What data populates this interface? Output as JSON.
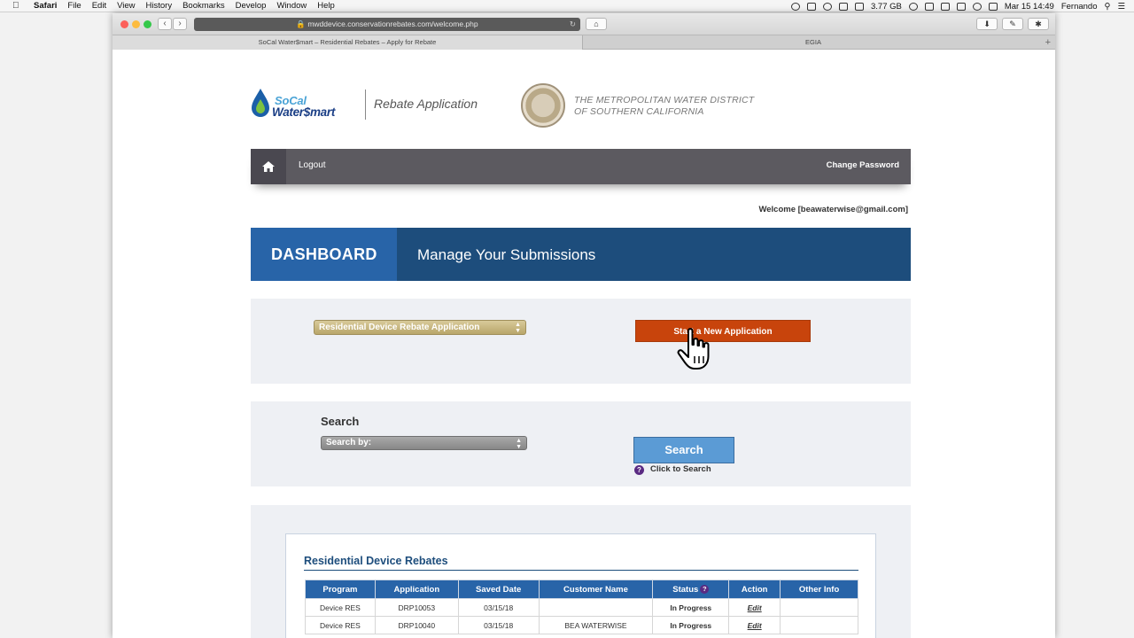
{
  "menubar": {
    "app": "Safari",
    "items": [
      "File",
      "Edit",
      "View",
      "History",
      "Bookmarks",
      "Develop",
      "Window",
      "Help"
    ],
    "storage": "3.77 GB",
    "clock": "Mar 15  14:49",
    "user": "Fernando"
  },
  "browser": {
    "url": "mwddevice.conservationrebates.com/welcome.php",
    "tabs": [
      {
        "label": "SoCal Water$mart – Residential Rebates – Apply for Rebate"
      },
      {
        "label": "EGIA"
      }
    ]
  },
  "header": {
    "logo_line1": "SoCal",
    "logo_line2": "Water$mart",
    "rebate_title": "Rebate Application",
    "mwd_line1": "THE METROPOLITAN WATER DISTRICT",
    "mwd_line2": "OF SOUTHERN CALIFORNIA"
  },
  "nav": {
    "logout": "Logout",
    "change_password": "Change Password"
  },
  "welcome": "Welcome [beawaterwise@gmail.com]",
  "dashboard": {
    "label": "DASHBOARD",
    "subtitle": "Manage Your Submissions"
  },
  "application_panel": {
    "selected_program": "Residential Device Rebate Application",
    "start_button": "Start a New Application"
  },
  "search_panel": {
    "label": "Search",
    "search_by": "Search by:",
    "search_button": "Search",
    "hint": "Click to Search"
  },
  "rebates": {
    "title": "Residential Device Rebates",
    "columns": [
      "Program",
      "Application",
      "Saved Date",
      "Customer Name",
      "Status",
      "Action",
      "Other Info"
    ],
    "rows": [
      {
        "program": "Device RES",
        "application": "DRP10053",
        "saved_date": "03/15/18",
        "customer": "",
        "status": "In Progress",
        "action": "Edit",
        "other": ""
      },
      {
        "program": "Device RES",
        "application": "DRP10040",
        "saved_date": "03/15/18",
        "customer": "BEA WATERWISE",
        "status": "In Progress",
        "action": "Edit",
        "other": ""
      }
    ]
  },
  "colors": {
    "nav_bg": "#5c5a60",
    "dashboard_dark": "#1d4d7c",
    "dashboard_light": "#2864a8",
    "start_button": "#c8440c",
    "search_button": "#5b9bd5"
  }
}
